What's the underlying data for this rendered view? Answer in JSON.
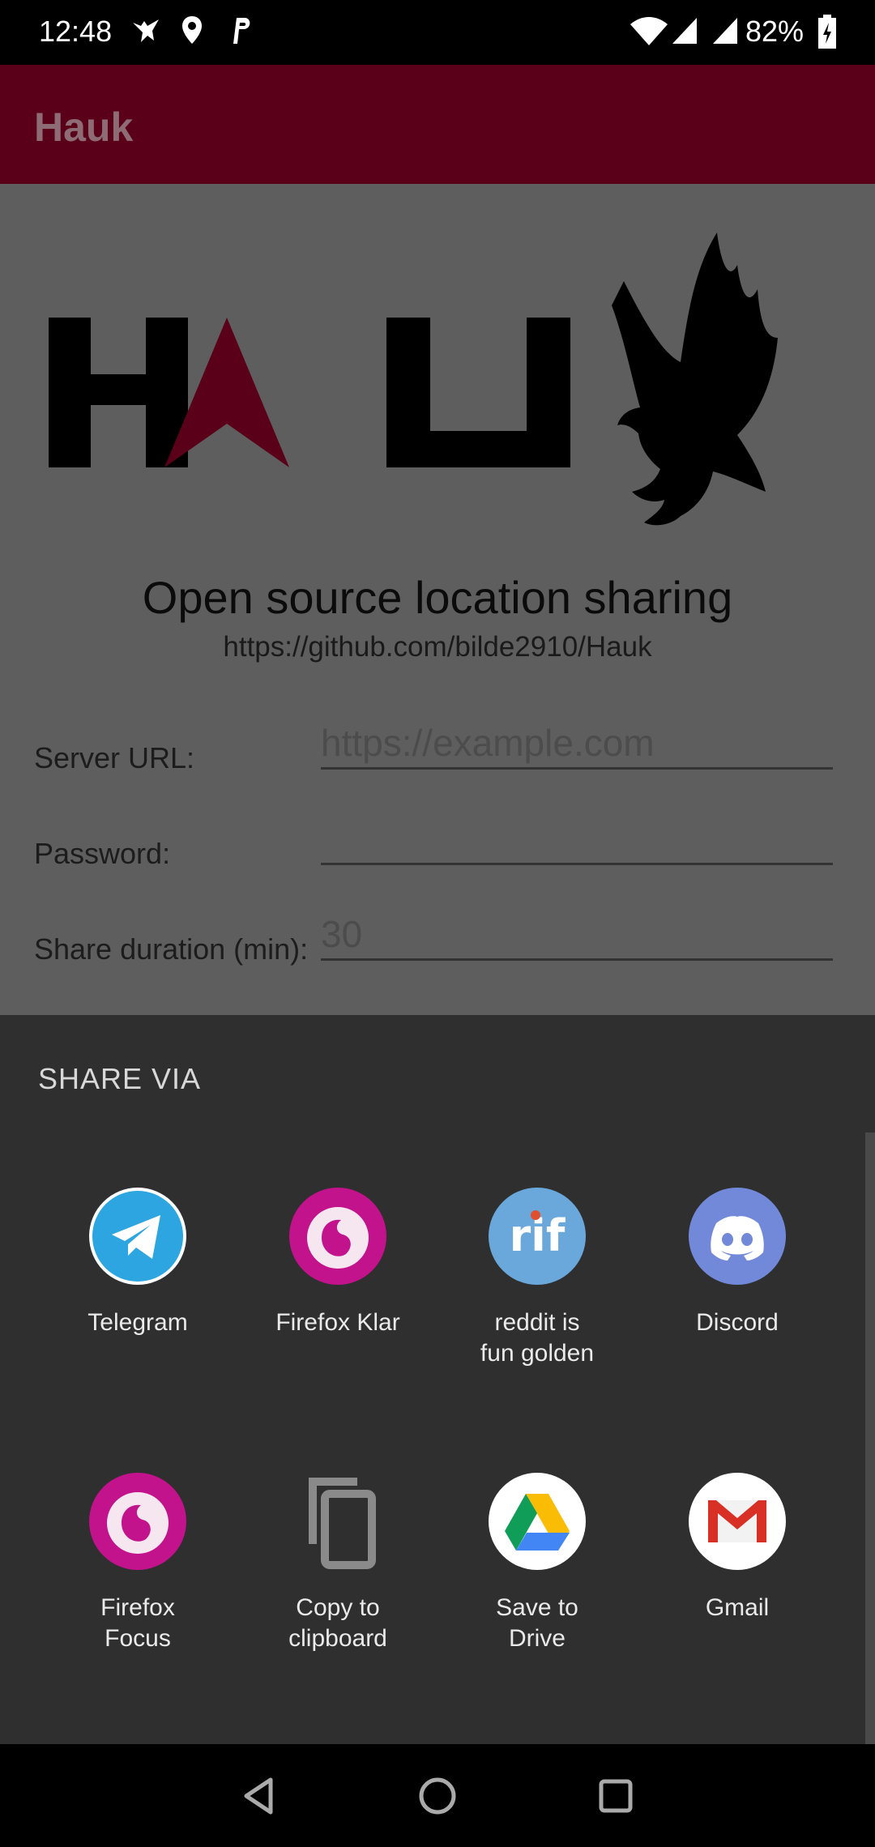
{
  "status_bar": {
    "time": "12:48",
    "battery": "82%",
    "icons": [
      "eagle-notification-icon",
      "location-icon",
      "parking-icon",
      "wifi-icon",
      "signal-icon",
      "signal-icon",
      "battery-charging-icon"
    ]
  },
  "app_bar": {
    "title": "Hauk"
  },
  "background": {
    "logo_letters": "HAU",
    "tagline": "Open source location sharing",
    "repo_link": "https://github.com/bilde2910/Hauk",
    "form": {
      "server_url_label": "Server URL:",
      "server_url_placeholder": "https://example.com",
      "password_label": "Password:",
      "password_value": "",
      "duration_label": "Share duration (min):",
      "duration_placeholder": "30"
    }
  },
  "share_sheet": {
    "title": "SHARE VIA",
    "apps": [
      {
        "label": "Telegram",
        "icon": "telegram-icon",
        "color": "#2ca5e0"
      },
      {
        "label": "Firefox Klar",
        "icon": "firefox-klar-icon",
        "color": "#c2128c"
      },
      {
        "label": "reddit is\nfun golden",
        "icon": "rif-icon",
        "color": "#6aa8dc"
      },
      {
        "label": "Discord",
        "icon": "discord-icon",
        "color": "#7289da"
      },
      {
        "label": "Firefox\nFocus",
        "icon": "firefox-focus-icon",
        "color": "#c2128c"
      },
      {
        "label": "Copy to\nclipboard",
        "icon": "copy-icon",
        "color": "#8a8a8a"
      },
      {
        "label": "Save to\nDrive",
        "icon": "google-drive-icon",
        "color": "#ffffff"
      },
      {
        "label": "Gmail",
        "icon": "gmail-icon",
        "color": "#ffffff"
      }
    ]
  },
  "nav_bar": {
    "buttons": [
      "back-icon",
      "home-icon",
      "recents-icon"
    ]
  },
  "colors": {
    "accent": "#5a0019",
    "sheet_background": "#2f2f2f"
  }
}
